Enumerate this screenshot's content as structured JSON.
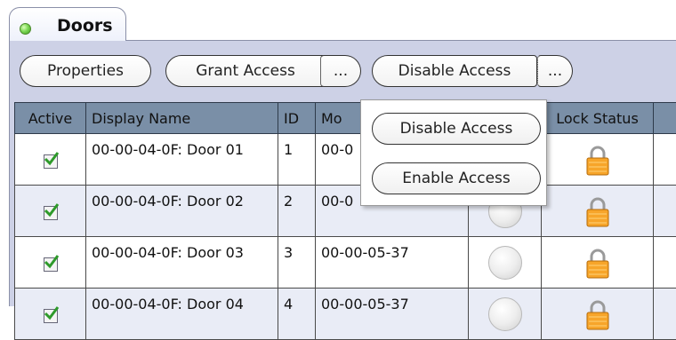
{
  "tab": {
    "label": "Doors",
    "status_color": "#5cc23a"
  },
  "toolbar": {
    "properties_label": "Properties",
    "grant_access_label": "Grant Access",
    "grant_more_label": "...",
    "disable_access_label": "Disable Access",
    "disable_more_label": "..."
  },
  "grid": {
    "columns": [
      "Active",
      "Display Name",
      "ID",
      "Mo",
      "",
      "Lock Status",
      ""
    ],
    "rows": [
      {
        "active": true,
        "display_name": "00-00-04-0F: Door 01",
        "id": "1",
        "model": "00-0",
        "lock_status": "locked"
      },
      {
        "active": true,
        "display_name": "00-00-04-0F: Door 02",
        "id": "2",
        "model": "00-0",
        "lock_status": "locked"
      },
      {
        "active": true,
        "display_name": "00-00-04-0F: Door 03",
        "id": "3",
        "model": "00-00-05-37",
        "lock_status": "locked"
      },
      {
        "active": true,
        "display_name": "00-00-04-0F: Door 04",
        "id": "4",
        "model": "00-00-05-37",
        "lock_status": "locked"
      }
    ]
  },
  "dropdown": {
    "items": [
      "Disable Access",
      "Enable Access"
    ]
  },
  "icons": {
    "checkbox": "checkmark-icon",
    "lock": "padlock-icon",
    "indicator": "status-led-icon"
  }
}
